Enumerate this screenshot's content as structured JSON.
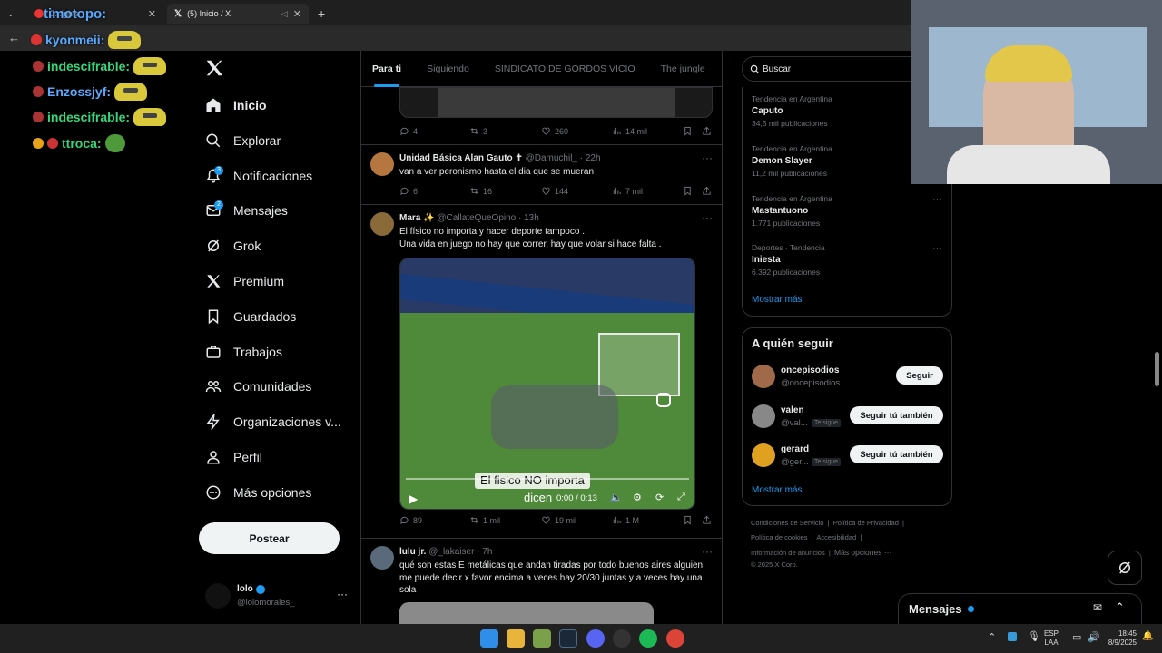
{
  "browser": {
    "tabs": [
      {
        "label": "C...ights",
        "active": false
      },
      {
        "label": "(5) Inicio / X",
        "active": true
      }
    ],
    "new_tab": "+"
  },
  "stream_overlay": {
    "streamer": "timotopo:",
    "chat": [
      {
        "user": "kyonmeii:",
        "color": "#5aa9ff"
      },
      {
        "user": "indescifrable:",
        "color": "#37d67a"
      },
      {
        "user": "Enzossjyf:",
        "color": "#5aa9ff"
      },
      {
        "user": "indescifrable:",
        "color": "#37d67a"
      },
      {
        "user": "ttroca:",
        "color": "#37d67a"
      }
    ]
  },
  "nav": {
    "items": [
      {
        "label": "Inicio",
        "icon": "home-icon"
      },
      {
        "label": "Explorar",
        "icon": "search-icon"
      },
      {
        "label": "Notificaciones",
        "icon": "bell-icon",
        "badge": "3"
      },
      {
        "label": "Mensajes",
        "icon": "mail-icon",
        "badge": "2"
      },
      {
        "label": "Grok",
        "icon": "grok-icon"
      },
      {
        "label": "Premium",
        "icon": "x-logo-icon"
      },
      {
        "label": "Guardados",
        "icon": "bookmark-icon"
      },
      {
        "label": "Trabajos",
        "icon": "briefcase-icon"
      },
      {
        "label": "Comunidades",
        "icon": "people-icon"
      },
      {
        "label": "Organizaciones v...",
        "icon": "lightning-icon"
      },
      {
        "label": "Perfil",
        "icon": "person-icon"
      },
      {
        "label": "Más opciones",
        "icon": "more-circle-icon"
      }
    ],
    "post_button": "Postear",
    "account": {
      "name": "lolo",
      "handle": "@lolomorales_"
    }
  },
  "feed": {
    "tabs": [
      "Para ti",
      "Siguiendo",
      "SINDICATO DE GORDOS VICIO",
      "The jungle"
    ],
    "tweets": [
      {
        "stats": {
          "replies": "4",
          "retweets": "3",
          "likes": "260",
          "views": "14 mil"
        }
      },
      {
        "name": "Unidad Básica Alan Gauto ✝",
        "handle": "@Damuchil_ · 22h",
        "text": "van a ver peronismo hasta el dia que se mueran",
        "stats": {
          "replies": "6",
          "retweets": "16",
          "likes": "144",
          "views": "7 mil"
        }
      },
      {
        "name": "Mara ✨",
        "handle": "@CallateQueOpino · 13h",
        "text1": "El físico no importa y hacer deporte tampoco .",
        "text2": "Una vida en juego no hay que correr, hay que volar si hace falta .",
        "video": {
          "caption": "El fisico NO importa",
          "caption2": "dicen",
          "time": "0:00 / 0:13"
        },
        "stats": {
          "replies": "89",
          "retweets": "1 mil",
          "likes": "19 mil",
          "views": "1 M"
        }
      },
      {
        "name": "lulu jr.",
        "handle": "@_lakaiser · 7h",
        "text": "qué son estas E metálicas que andan tiradas por todo buenos aires alguien me puede decir x favor encima a veces hay 20/30 juntas y a veces hay una sola"
      }
    ]
  },
  "sidebar": {
    "search_placeholder": "Buscar",
    "trends": [
      {
        "context": "Tendencia en Argentina",
        "name": "Caputo",
        "count": "34,5 mil publicaciones"
      },
      {
        "context": "Tendencia en Argentina",
        "name": "Demon Slayer",
        "count": "11,2 mil publicaciones"
      },
      {
        "context": "Tendencia en Argentina",
        "name": "Mastantuono",
        "count": "1.771 publicaciones"
      },
      {
        "context": "Deportes · Tendencia",
        "name": "Iniesta",
        "count": "6.392 publicaciones"
      }
    ],
    "show_more": "Mostrar más",
    "who_to_follow": {
      "title": "A quién seguir",
      "users": [
        {
          "name": "oncepisodios",
          "handle": "@oncepisodios",
          "button": "Seguir",
          "follows_you": ""
        },
        {
          "name": "valen",
          "handle": "@val...",
          "button": "Seguir tú también",
          "follows_you": "Te sigue"
        },
        {
          "name": "gerard",
          "handle": "@ger...",
          "button": "Seguir tú también",
          "follows_you": "Te sigue"
        }
      ],
      "show_more": "Mostrar más"
    },
    "footer": {
      "line1": [
        "Condiciones de Servicio",
        "Política de Privacidad"
      ],
      "line2": [
        "Política de cookies",
        "Accesibilidad"
      ],
      "line3": [
        "Información de anuncios",
        "Más opciones ···"
      ],
      "copyright": "© 2025 X Corp."
    },
    "messages_drawer": "Mensajes"
  },
  "taskbar": {
    "lang1": "ESP",
    "lang2": "LAA",
    "time": "18:45",
    "date": "8/9/2025"
  }
}
